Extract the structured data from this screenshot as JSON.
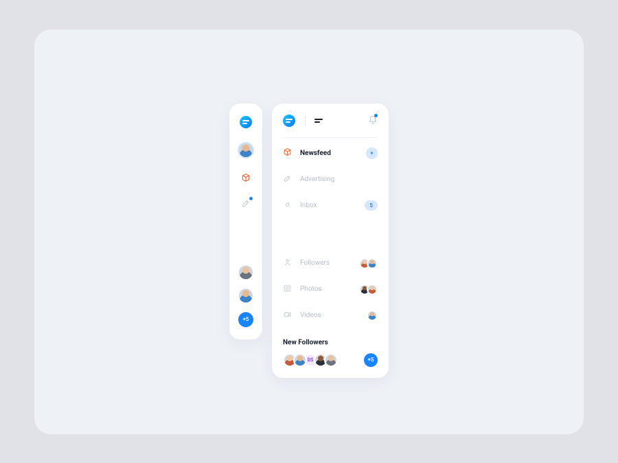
{
  "rail": {
    "badge": "+5"
  },
  "nav": {
    "items": [
      {
        "label": "Newsfeed",
        "badge": "+"
      },
      {
        "label": "Advertising"
      },
      {
        "label": "Inbox",
        "badge": "5"
      },
      {
        "label": "Followers"
      },
      {
        "label": "Photos"
      },
      {
        "label": "Videos"
      }
    ]
  },
  "followers": {
    "title": "New Followers",
    "initials": "DS",
    "more_badge": "+5"
  }
}
